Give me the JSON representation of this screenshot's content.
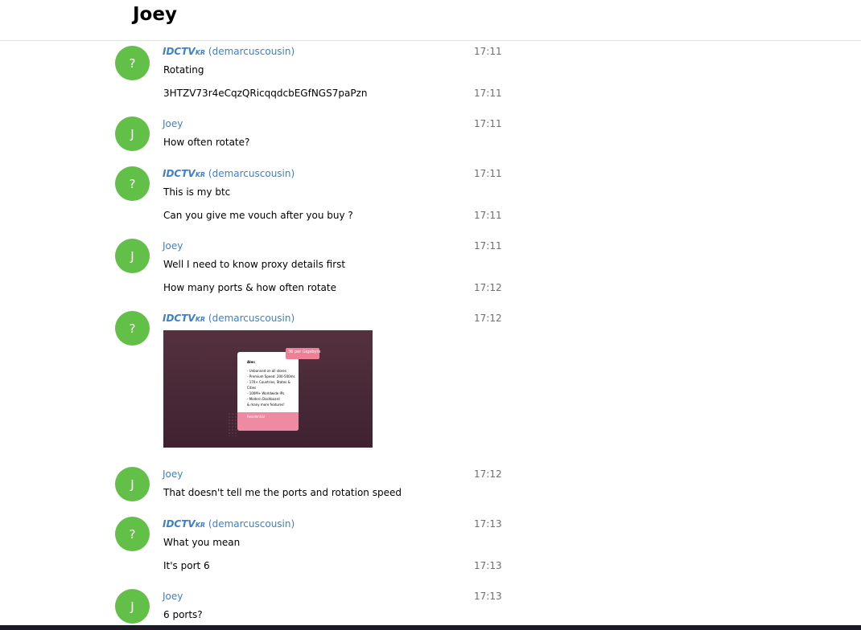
{
  "header": {
    "title": "Joey"
  },
  "sender_tag": "IDCTV",
  "sender_tag_sub": "KR",
  "messages": [
    {
      "avatar": "?",
      "handle": "(demarcuscousin)",
      "lines": [
        {
          "text": "Rotating",
          "time": "17:11"
        },
        {
          "text": "3HTZV73r4eCqzQRicqqdcbEGfNGS7paPzn",
          "time": "17:11"
        }
      ]
    },
    {
      "avatar": "J",
      "name": "Joey",
      "lines": [
        {
          "text": "How often rotate?",
          "time": "17:11"
        }
      ]
    },
    {
      "avatar": "?",
      "handle": "(demarcuscousin)",
      "lines": [
        {
          "text": "This is my btc",
          "time": "17:11"
        },
        {
          "text": "Can you give me vouch after you buy ?",
          "time": "17:11"
        }
      ]
    },
    {
      "avatar": "J",
      "name": "Joey",
      "lines": [
        {
          "text": "Well I need to know proxy details first",
          "time": "17:11"
        },
        {
          "text": "How many ports & how often rotate",
          "time": "17:12"
        }
      ]
    },
    {
      "avatar": "?",
      "handle": "(demarcuscousin)",
      "time": "17:12",
      "image": {
        "badge": "36 per Gigabyte",
        "title": "Alm:",
        "features": [
          "- Unbanned on all stores",
          "- Premium Speed: 200-500ms",
          "- 170+ Countries, States & Cities",
          "- 100M+ Worldwide IPs",
          "- Modern Dashboard",
          "& many more features!"
        ],
        "footer": "Residential"
      }
    },
    {
      "avatar": "J",
      "name": "Joey",
      "lines": [
        {
          "text": "That doesn't tell me the ports and rotation speed",
          "time": "17:12"
        }
      ]
    },
    {
      "avatar": "?",
      "handle": "(demarcuscousin)",
      "lines": [
        {
          "text": "What you mean",
          "time": "17:13"
        },
        {
          "text": "It's port 6",
          "time": "17:13"
        }
      ]
    },
    {
      "avatar": "J",
      "name": "Joey",
      "lines": [
        {
          "text": "6 ports?",
          "time": "17:13"
        }
      ]
    }
  ]
}
